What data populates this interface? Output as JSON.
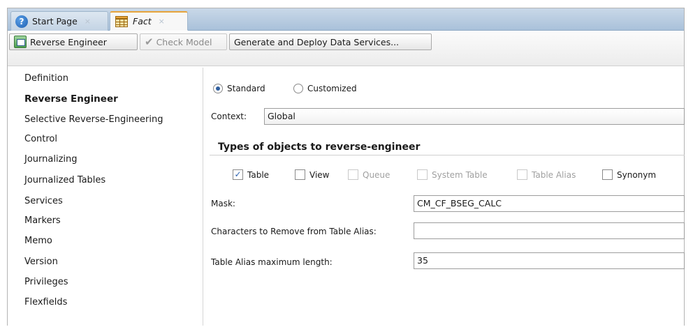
{
  "tabs": [
    {
      "label": "Start Page",
      "icon": "help-icon"
    },
    {
      "label": "Fact",
      "icon": "fact-table-icon",
      "active": true
    }
  ],
  "toolbar": {
    "reverse_engineer": "Reverse Engineer",
    "check_model": "Check Model",
    "generate": "Generate and Deploy Data Services..."
  },
  "nav": {
    "items": [
      {
        "label": "Definition"
      },
      {
        "label": "Reverse Engineer",
        "active": true
      },
      {
        "label": "Selective Reverse-Engineering"
      },
      {
        "label": "Control"
      },
      {
        "label": "Journalizing"
      },
      {
        "label": "Journalized Tables"
      },
      {
        "label": "Services"
      },
      {
        "label": "Markers"
      },
      {
        "label": "Memo"
      },
      {
        "label": "Version"
      },
      {
        "label": "Privileges"
      },
      {
        "label": "Flexfields"
      }
    ]
  },
  "panel": {
    "mode_standard": "Standard",
    "mode_customized": "Customized",
    "selected_mode": "Standard",
    "context_label": "Context:",
    "context_value": "Global",
    "types_title": "Types of objects to reverse-engineer",
    "types": [
      {
        "label": "Table",
        "checked": true,
        "enabled": true
      },
      {
        "label": "View",
        "checked": false,
        "enabled": true
      },
      {
        "label": "Queue",
        "checked": false,
        "enabled": false
      },
      {
        "label": "System Table",
        "checked": false,
        "enabled": false
      },
      {
        "label": "Table Alias",
        "checked": false,
        "enabled": false
      },
      {
        "label": "Synonym",
        "checked": false,
        "enabled": true
      }
    ],
    "mask_label": "Mask:",
    "mask_value": "CM_CF_BSEG_CALC",
    "chars_label": "Characters to Remove from Table Alias:",
    "chars_value": "",
    "alias_len_label": "Table Alias maximum length:",
    "alias_len_value": "35"
  }
}
